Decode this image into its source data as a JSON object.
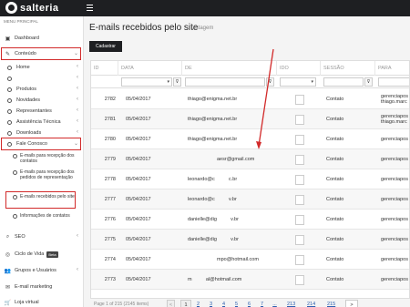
{
  "app": {
    "logo_text": "salteria"
  },
  "sidebar": {
    "header": "MENU PRINCIPAL",
    "dashboard": "Dashboard",
    "conteudo": "Conteúdo",
    "sub": [
      "Home",
      "",
      "Produtos",
      "Novidades",
      "Representantes",
      "Assistência Técnica",
      "Downloads"
    ],
    "fale_conosco": "Fale Conosco",
    "fale_items": [
      "E-mails para recepção dos contatos",
      "E-mails para recepção dos pedidos de representação",
      "E-mails recebidos pelo site",
      "Informações de contatos"
    ],
    "seo": "SEO",
    "ciclo_de_vida": "Ciclo de Vida",
    "beta": "Beta",
    "grupos": "Grupos e Usuários",
    "email_marketing": "E-mail marketing",
    "loja_virtual": "Loja virtual"
  },
  "main": {
    "title": "E-mails recebidos pelo site",
    "subtitle": "Listagem",
    "cadastrar": "Cadastrar"
  },
  "table": {
    "headers": [
      "ID",
      "DATA",
      "DE",
      "IDO",
      "SESSÃO",
      "PARA"
    ],
    "rows": [
      {
        "id": "2782",
        "data": "05/04/2017",
        "de": "thiago@enigma.net.br",
        "sessao": "Contato",
        "para": "gerenciapos thiago.marc"
      },
      {
        "id": "2781",
        "data": "05/04/2017",
        "de": "thiago@enigma.net.br",
        "sessao": "Contato",
        "para": "gerenciapos thiago.marc"
      },
      {
        "id": "2780",
        "data": "05/04/2017",
        "de": "thiago@enigma.net.br",
        "sessao": "Contato",
        "para": "gerenciapos"
      },
      {
        "id": "2779",
        "data": "05/04/2017",
        "de": "aesr@gmail.com",
        "sessao": "Contato",
        "para": "gerenciapos"
      },
      {
        "id": "2778",
        "data": "05/04/2017",
        "de": "leonardo@c          c.br",
        "sessao": "Contato",
        "para": "gerenciapos"
      },
      {
        "id": "2777",
        "data": "05/04/2017",
        "de": "leonardo@c          v.br",
        "sessao": "Contato",
        "para": "gerenciapos"
      },
      {
        "id": "2776",
        "data": "05/04/2017",
        "de": "danielle@dig          v.br",
        "sessao": "Contato",
        "para": "gerenciapos"
      },
      {
        "id": "2775",
        "data": "05/04/2017",
        "de": "danielle@dig          v.br",
        "sessao": "Contato",
        "para": "gerenciapos"
      },
      {
        "id": "2774",
        "data": "05/04/2017",
        "de": "mpo@hotmail.com",
        "sessao": "Contato",
        "para": "gerenciapos"
      },
      {
        "id": "2773",
        "data": "05/04/2017",
        "de": "m          al@hotmail.com",
        "sessao": "Contato",
        "para": "gerenciapos"
      }
    ]
  },
  "pager": {
    "info": "Page 1 of 215 (2145 items)",
    "prev": "<",
    "pages": [
      "1",
      "2",
      "3",
      "4",
      "5",
      "6",
      "7",
      "...",
      "213",
      "214",
      "215"
    ],
    "next": ">"
  }
}
